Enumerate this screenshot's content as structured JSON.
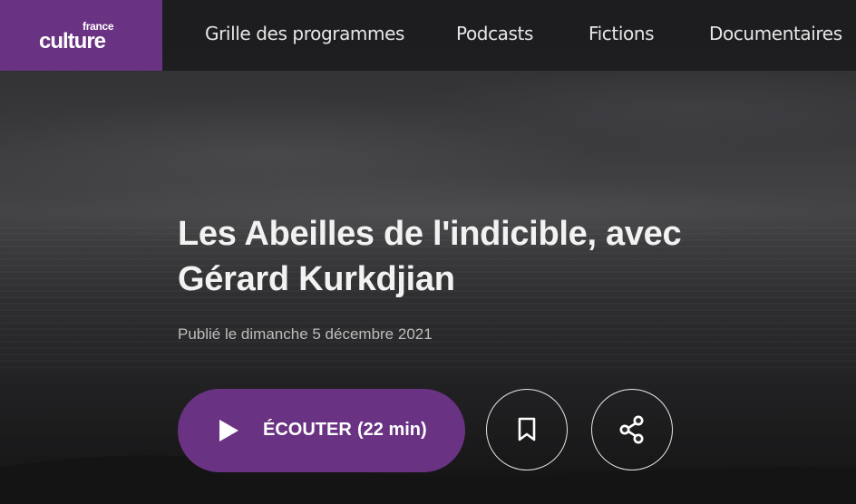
{
  "brand": {
    "logo_top": "france",
    "logo_main": "culture",
    "color": "#6a3282"
  },
  "nav": {
    "items": [
      {
        "label": "Grille des programmes"
      },
      {
        "label": "Podcasts"
      },
      {
        "label": "Fictions"
      },
      {
        "label": "Documentaires"
      }
    ]
  },
  "episode": {
    "title_line1": "Les Abeilles de l'indicible, avec",
    "title_line2": "Gérard Kurkdjian",
    "published": "Publié le dimanche 5 décembre 2021"
  },
  "player": {
    "listen_label": "ÉCOUTER",
    "duration": "(22 min)",
    "play_icon": "play-icon",
    "bookmark_icon": "bookmark-icon",
    "share_icon": "share-icon"
  }
}
